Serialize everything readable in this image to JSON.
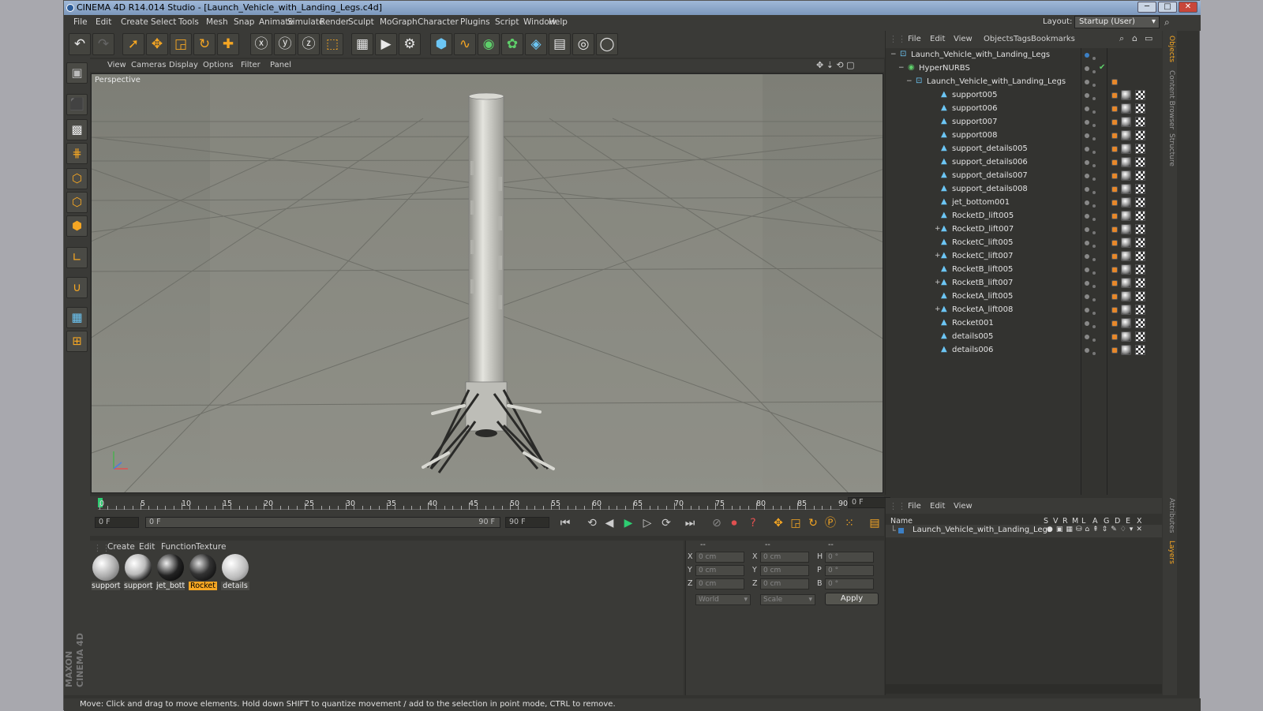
{
  "window": {
    "title": "CINEMA 4D R14.014 Studio - [Launch_Vehicle_with_Landing_Legs.c4d]",
    "minimize": "─",
    "maximize": "□",
    "close": "✕"
  },
  "menubar": [
    "File",
    "Edit",
    "Create",
    "Select",
    "Tools",
    "Mesh",
    "Snap",
    "Animate",
    "Simulate",
    "Render",
    "Sculpt",
    "MoGraph",
    "Character",
    "Plugins",
    "Script",
    "Window",
    "Help"
  ],
  "layout": {
    "label": "Layout:",
    "value": "Startup (User)"
  },
  "viewport": {
    "menu": [
      "View",
      "Cameras",
      "Display",
      "Options",
      "Filter",
      "Panel"
    ],
    "label": "Perspective"
  },
  "timeline": {
    "ticks": [
      "0",
      "5",
      "10",
      "15",
      "20",
      "25",
      "30",
      "35",
      "40",
      "45",
      "50",
      "55",
      "60",
      "65",
      "70",
      "75",
      "80",
      "85",
      "90"
    ],
    "current_frame": "0 F",
    "start": "0 F",
    "range_start": "0 F",
    "range_end": "90 F",
    "end": "90 F"
  },
  "material_manager": {
    "menu": [
      "Create",
      "Edit",
      "Function",
      "Texture"
    ],
    "materials": [
      "support",
      "support",
      "jet_bott",
      "Rocket",
      "details"
    ],
    "selected_index": 3
  },
  "coordinates": {
    "header": [
      "--",
      "--",
      "--"
    ],
    "rows": [
      {
        "a": "X",
        "av": "0 cm",
        "b": "X",
        "bv": "0 cm",
        "c": "H",
        "cv": "0 °"
      },
      {
        "a": "Y",
        "av": "0 cm",
        "b": "Y",
        "bv": "0 cm",
        "c": "P",
        "cv": "0 °"
      },
      {
        "a": "Z",
        "av": "0 cm",
        "b": "Z",
        "bv": "0 cm",
        "c": "B",
        "cv": "0 °"
      }
    ],
    "mode": "World",
    "scale": "Scale",
    "apply": "Apply"
  },
  "object_manager": {
    "menu": [
      "File",
      "Edit",
      "View",
      "Objects",
      "Tags",
      "Bookmarks"
    ],
    "objects": [
      {
        "name": "Launch_Vehicle_with_Landing_Legs",
        "indent": 0,
        "expand": "−"
      },
      {
        "name": "HyperNURBS",
        "indent": 1,
        "expand": "−"
      },
      {
        "name": "Launch_Vehicle_with_Landing_Legs",
        "indent": 2,
        "expand": "−"
      },
      {
        "name": "support005",
        "indent": 3,
        "expand": ""
      },
      {
        "name": "support006",
        "indent": 3,
        "expand": ""
      },
      {
        "name": "support007",
        "indent": 3,
        "expand": ""
      },
      {
        "name": "support008",
        "indent": 3,
        "expand": ""
      },
      {
        "name": "support_details005",
        "indent": 3,
        "expand": ""
      },
      {
        "name": "support_details006",
        "indent": 3,
        "expand": ""
      },
      {
        "name": "support_details007",
        "indent": 3,
        "expand": ""
      },
      {
        "name": "support_details008",
        "indent": 3,
        "expand": ""
      },
      {
        "name": "jet_bottom001",
        "indent": 3,
        "expand": ""
      },
      {
        "name": "RocketD_lift005",
        "indent": 3,
        "expand": ""
      },
      {
        "name": "RocketD_lift007",
        "indent": 3,
        "expand": "+"
      },
      {
        "name": "RocketC_lift005",
        "indent": 3,
        "expand": ""
      },
      {
        "name": "RocketC_lift007",
        "indent": 3,
        "expand": "+"
      },
      {
        "name": "RocketB_lift005",
        "indent": 3,
        "expand": ""
      },
      {
        "name": "RocketB_lift007",
        "indent": 3,
        "expand": "+"
      },
      {
        "name": "RocketA_lift005",
        "indent": 3,
        "expand": ""
      },
      {
        "name": "RocketA_lift008",
        "indent": 3,
        "expand": "+"
      },
      {
        "name": "Rocket001",
        "indent": 3,
        "expand": ""
      },
      {
        "name": "details005",
        "indent": 3,
        "expand": ""
      },
      {
        "name": "details006",
        "indent": 3,
        "expand": ""
      }
    ]
  },
  "side_tabs": [
    "Objects",
    "Content Browser",
    "Structure",
    "Attributes",
    "Layers"
  ],
  "attribute_manager": {
    "menu": [
      "File",
      "Edit",
      "View"
    ],
    "columns": [
      "Name",
      "S",
      "V",
      "R",
      "M",
      "L",
      "A",
      "G",
      "D",
      "E",
      "X"
    ],
    "row": "Launch_Vehicle_with_Landing_Legs"
  },
  "status": "Move: Click and drag to move elements. Hold down SHIFT to quantize movement / add to the selection in point mode, CTRL to remove.",
  "maxon": "MAXON CINEMA 4D",
  "colors": {
    "accent": "#f5a623",
    "ui_bg": "#333330",
    "viewport_bg": "#8a8b83"
  }
}
